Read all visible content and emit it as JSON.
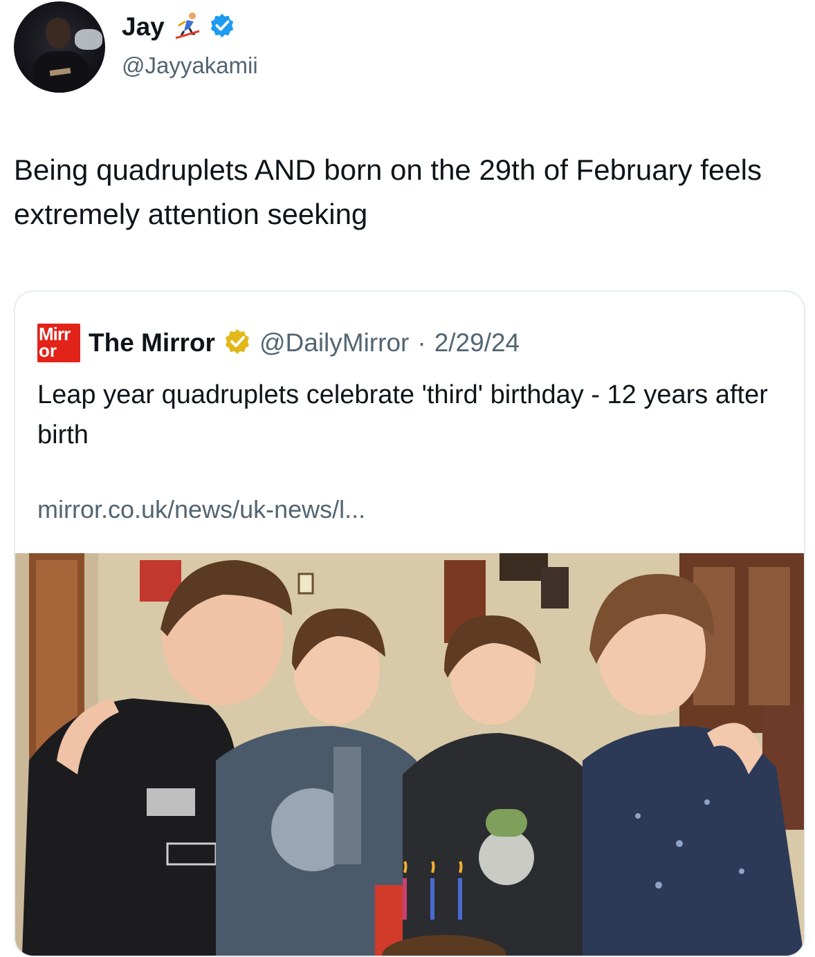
{
  "tweet": {
    "author": {
      "display_name": "Jay",
      "handle": "@Jayyakamii",
      "verified": true
    },
    "text": "Being quadruplets AND born on the 29th of February feels extremely attention seeking"
  },
  "quoted_tweet": {
    "logo_text_line1": "Mirr",
    "logo_text_line2": "or",
    "author_name": "The Mirror",
    "handle": "@DailyMirror",
    "separator": "·",
    "date": "2/29/24",
    "text": "Leap year quadruplets celebrate 'third' birthday - 12 years after birth",
    "link": "mirror.co.uk/news/uk-news/l...",
    "image": {
      "subject": "four-boys-photo"
    }
  },
  "colors": {
    "text_primary": "#0f1419",
    "text_secondary": "#536471",
    "verified_blue": "#1d9bf0",
    "verified_gold": "#e2b719",
    "mirror_red": "#e2231a",
    "card_border": "#e6ecf0"
  },
  "icons": {
    "verified": "verified-badge-icon",
    "gold_verified": "gold-verified-badge-icon",
    "emoji": "skier-emoji-icon"
  }
}
